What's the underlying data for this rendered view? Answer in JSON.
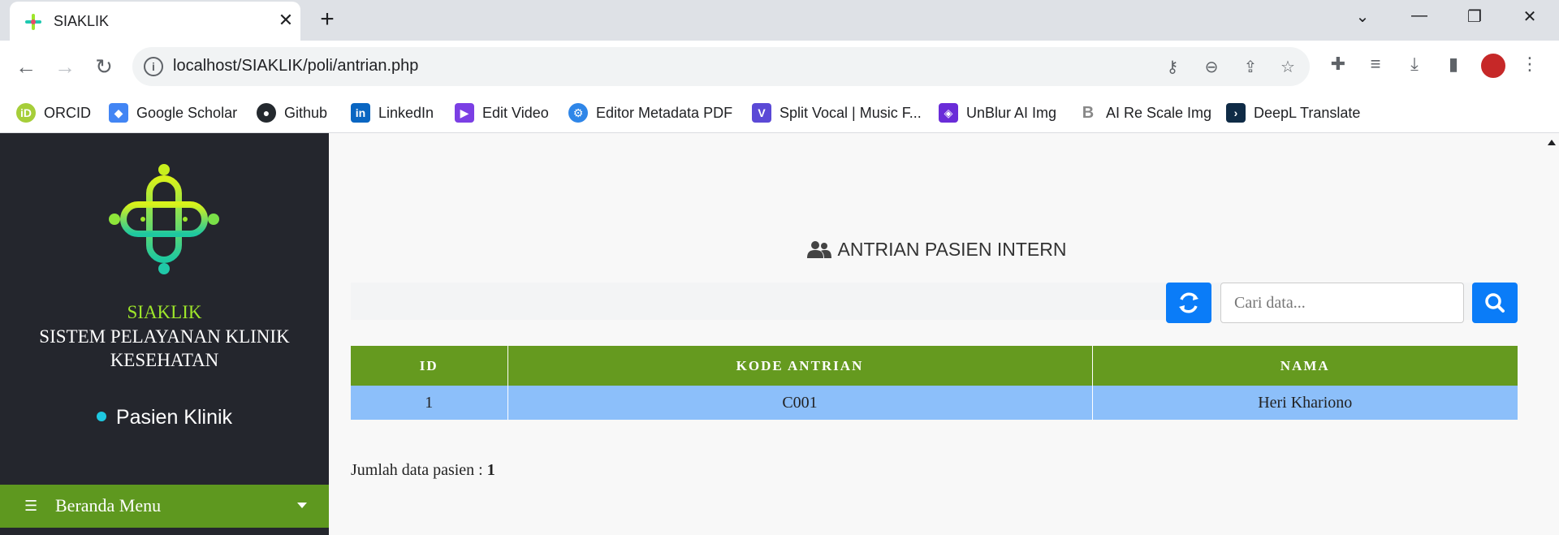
{
  "browser": {
    "tab_title": "SIAKLIK",
    "url": "localhost/SIAKLIK/poli/antrian.php",
    "bookmarks": [
      {
        "label": "ORCID",
        "icon": "orcid-icon",
        "color": "#a6ce39"
      },
      {
        "label": "Google Scholar",
        "icon": "google-scholar-icon",
        "color": "#4285f4"
      },
      {
        "label": "Github",
        "icon": "github-icon",
        "color": "#24292e"
      },
      {
        "label": "LinkedIn",
        "icon": "linkedin-icon",
        "color": "#0a66c2"
      },
      {
        "label": "Edit Video",
        "icon": "edit-video-icon",
        "color": "#7b3fe4"
      },
      {
        "label": "Editor Metadata PDF",
        "icon": "metadata-icon",
        "color": "#2f86e8"
      },
      {
        "label": "Split Vocal | Music F...",
        "icon": "split-vocal-icon",
        "color": "#5b49d6"
      },
      {
        "label": "UnBlur AI Img",
        "icon": "unblur-icon",
        "color": "#6a2cd8"
      },
      {
        "label": "AI Re Scale Img",
        "icon": "rescale-icon",
        "color": "#888888"
      },
      {
        "label": "DeepL Translate",
        "icon": "deepl-icon",
        "color": "#0f2b46"
      }
    ]
  },
  "sidebar": {
    "brand": "SIAKLIK",
    "brand_subtitle": "SISTEM PELAYANAN KLINIK KESEHATAN",
    "active_item": "Pasien Klinik",
    "menu_label": "Beranda Menu"
  },
  "main": {
    "title": "ANTRIAN PASIEN INTERN",
    "search_placeholder": "Cari data...",
    "table": {
      "headers": [
        "ID",
        "KODE ANTRIAN",
        "NAMA"
      ],
      "rows": [
        [
          "1",
          "C001",
          "Heri Khariono"
        ]
      ]
    },
    "count_label": "Jumlah data pasien :",
    "count_value": "1"
  },
  "colors": {
    "sidebar_bg": "#24262d",
    "accent_green": "#659a1f",
    "brand_green": "#9ee62a",
    "primary_blue": "#0a7cf8",
    "row_blue": "#8cbffa"
  }
}
